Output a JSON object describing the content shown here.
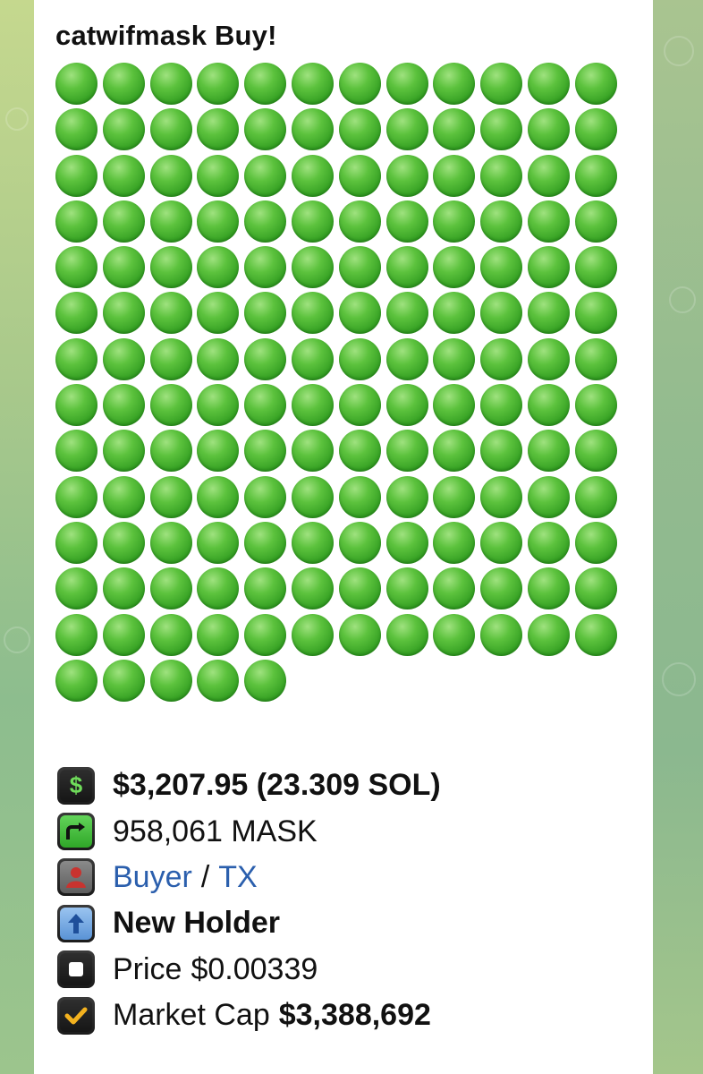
{
  "message": {
    "title": "catwifmask Buy!",
    "dot_count": 161,
    "dot_color": "#3aa827",
    "rows": [
      {
        "icon": "dollar-icon",
        "text": "$3,207.95 (23.309 SOL)"
      },
      {
        "icon": "swap-arrow-icon",
        "text": "958,061 MASK"
      },
      {
        "icon": "person-icon",
        "buyer_link": "Buyer",
        "separator": "/",
        "tx_link": "TX"
      },
      {
        "icon": "up-arrow-icon",
        "text": "New Holder"
      },
      {
        "icon": "stop-square-icon",
        "label": "Price",
        "value": "$0.00339"
      },
      {
        "icon": "checkmark-icon",
        "label": "Market Cap",
        "value": "$3,388,692"
      }
    ]
  }
}
